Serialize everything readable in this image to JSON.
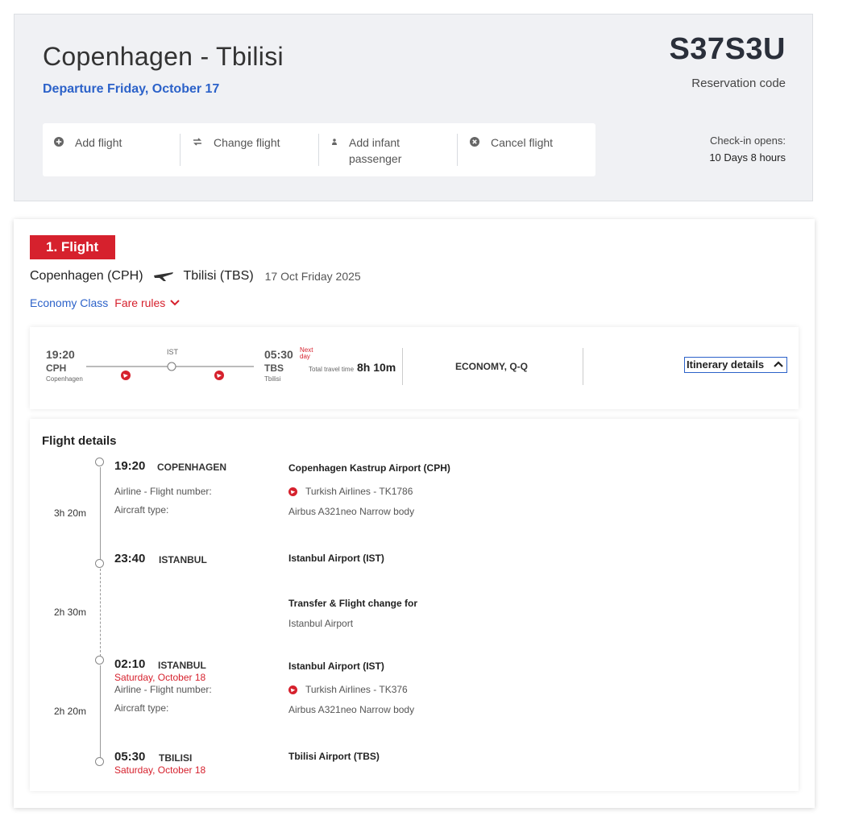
{
  "header": {
    "route": "Copenhagen - Tbilisi",
    "departure": "Departure Friday, October 17",
    "reservation_code": "S37S3U",
    "reservation_label": "Reservation code",
    "checkin_label": "Check-in opens:",
    "checkin_value": "10 Days 8 hours",
    "actions": [
      {
        "label": "Add flight",
        "icon": "plus-circle-icon"
      },
      {
        "label": "Change flight",
        "icon": "swap-icon"
      },
      {
        "label": "Add infant passenger",
        "icon": "person-icon"
      },
      {
        "label": "Cancel flight",
        "icon": "x-circle-icon"
      }
    ]
  },
  "flight": {
    "badge": "1. Flight",
    "origin": "Copenhagen (CPH)",
    "destination": "Tbilisi (TBS)",
    "date": "17 Oct Friday 2025",
    "cabin_class": "Economy Class",
    "fare_rules": "Fare rules"
  },
  "summary": {
    "dep_time": "19:20",
    "dep_code": "CPH",
    "dep_city": "Copenhagen",
    "stop_code": "IST",
    "arr_time": "05:30",
    "next_day": "Next day",
    "arr_code": "TBS",
    "arr_city": "Tbilisi",
    "total_label": "Total travel time",
    "total_duration": "8h 10m",
    "fare_class": "ECONOMY, Q-Q",
    "itinerary_button": "Itinerary details"
  },
  "details": {
    "title": "Flight details",
    "airline_label": "Airline - Flight number:",
    "aircraft_label": "Aircraft type:",
    "segments": [
      {
        "time": "19:20",
        "city": "COPENHAGEN",
        "airport": "Copenhagen Kastrup Airport (CPH)",
        "airline": "Turkish Airlines - TK1786",
        "aircraft": "Airbus A321neo Narrow body",
        "duration": "3h 20m"
      },
      {
        "time": "23:40",
        "city": "ISTANBUL",
        "airport": "Istanbul Airport (IST)"
      },
      {
        "transfer_title": "Transfer & Flight change for",
        "transfer_place": "Istanbul Airport",
        "duration": "2h 30m"
      },
      {
        "time": "02:10",
        "city": "ISTANBUL",
        "date": "Saturday, October 18",
        "airport": "Istanbul Airport (IST)",
        "airline": "Turkish Airlines - TK376",
        "aircraft": "Airbus A321neo Narrow body",
        "duration": "2h 20m"
      },
      {
        "time": "05:30",
        "city": "TBILISI",
        "date": "Saturday, October 18",
        "airport": "Tbilisi Airport (TBS)"
      }
    ]
  },
  "colors": {
    "brand_red": "#d6212d",
    "link_blue": "#2c62c9",
    "header_bg": "#f0f1f4"
  }
}
